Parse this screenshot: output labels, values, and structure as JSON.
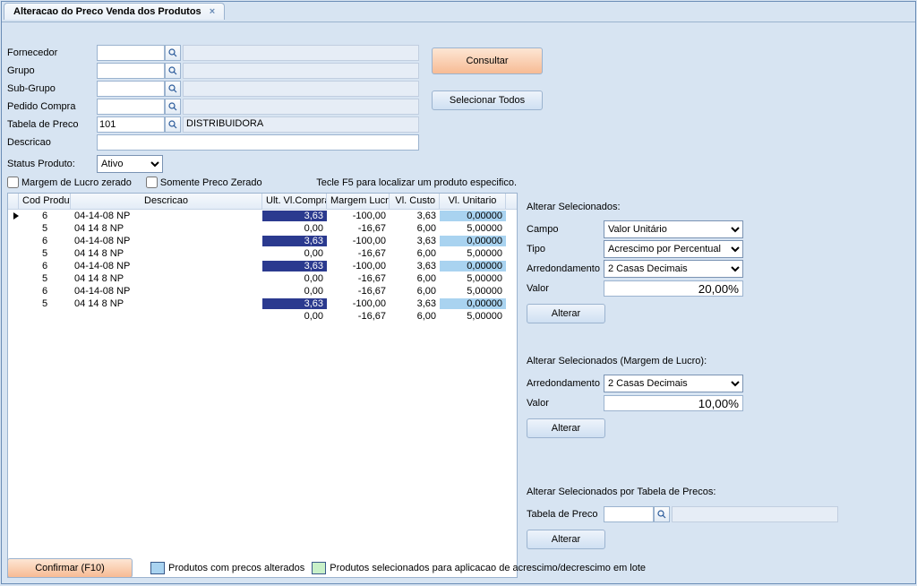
{
  "window": {
    "title": "Alteracao do Preco Venda dos Produtos"
  },
  "filters": {
    "labels": {
      "fornecedor": "Fornecedor",
      "grupo": "Grupo",
      "subgrupo": "Sub-Grupo",
      "pedido": "Pedido Compra",
      "tabela": "Tabela de Preco",
      "descricao": "Descricao",
      "status": "Status Produto:"
    },
    "values": {
      "fornecedor": "",
      "grupo": "",
      "subgrupo": "",
      "pedido": "",
      "tabela_cod": "101",
      "tabela_desc": "DISTRIBUIDORA",
      "descricao": "",
      "status": "Ativo"
    }
  },
  "buttons": {
    "consultar": "Consultar",
    "selecionar_todos": "Selecionar Todos",
    "confirmar": "Confirmar (F10)",
    "alterar": "Alterar"
  },
  "checks": {
    "margem_zerado": "Margem de Lucro zerado",
    "preco_zerado": "Somente Preco Zerado",
    "f5_hint": "Tecle F5 para localizar um produto especifico."
  },
  "grid": {
    "headers": {
      "cod": "Cod Produto",
      "desc": "Descricao",
      "ult": "Ult. Vl.Compra",
      "marg": "Margem Lucro",
      "custo": "Vl. Custo",
      "unit": "Vl. Unitario"
    },
    "rows": [
      {
        "cod": "6",
        "desc": "04-14-08 NP",
        "ult": "3,63",
        "marg": "-100,00",
        "custo": "3,63",
        "unit": "0,00000",
        "ult_dark": true,
        "unit_blue": true,
        "indicator": true
      },
      {
        "cod": "5",
        "desc": "04 14 8 NP",
        "ult": "0,00",
        "marg": "-16,67",
        "custo": "6,00",
        "unit": "5,00000"
      },
      {
        "cod": "6",
        "desc": "04-14-08 NP",
        "ult": "3,63",
        "marg": "-100,00",
        "custo": "3,63",
        "unit": "0,00000",
        "ult_dark": true,
        "unit_blue": true
      },
      {
        "cod": "5",
        "desc": "04 14 8 NP",
        "ult": "0,00",
        "marg": "-16,67",
        "custo": "6,00",
        "unit": "5,00000"
      },
      {
        "cod": "6",
        "desc": "04-14-08 NP",
        "ult": "3,63",
        "marg": "-100,00",
        "custo": "3,63",
        "unit": "0,00000",
        "ult_dark": true,
        "unit_blue": true
      },
      {
        "cod": "5",
        "desc": "04 14 8 NP",
        "ult": "0,00",
        "marg": "-16,67",
        "custo": "6,00",
        "unit": "5,00000"
      },
      {
        "cod": "6",
        "desc": "04-14-08 NP",
        "ult": "0,00",
        "marg": "-16,67",
        "custo": "6,00",
        "unit": "5,00000"
      },
      {
        "cod": "5",
        "desc": "04 14 8 NP",
        "ult": "3,63",
        "marg": "-100,00",
        "custo": "3,63",
        "unit": "0,00000",
        "ult_dark": true,
        "unit_blue": true
      },
      {
        "cod": "",
        "desc": "",
        "ult": "0,00",
        "marg": "-16,67",
        "custo": "6,00",
        "unit": "5,00000"
      }
    ]
  },
  "right": {
    "section1_title": "Alterar Selecionados:",
    "campo_label": "Campo",
    "campo_value": "Valor Unitário",
    "tipo_label": "Tipo",
    "tipo_value": "Acrescimo por Percentual",
    "arred_label": "Arredondamento",
    "arred_value": "2 Casas Decimais",
    "valor_label": "Valor",
    "valor_value": "20,00%",
    "section2_title": "Alterar Selecionados (Margem de Lucro):",
    "arred2_value": "2 Casas Decimais",
    "valor2_value": "10,00%",
    "section3_title": "Alterar Selecionados por Tabela de Precos:",
    "tabela_label": "Tabela de Preco"
  },
  "legend": {
    "alterados": "Produtos com precos alterados",
    "selecionados": "Produtos selecionados para aplicacao de acrescimo/decrescimo em lote",
    "color_alt": "#a9d3f0",
    "color_sel": "#c8f0c8"
  }
}
